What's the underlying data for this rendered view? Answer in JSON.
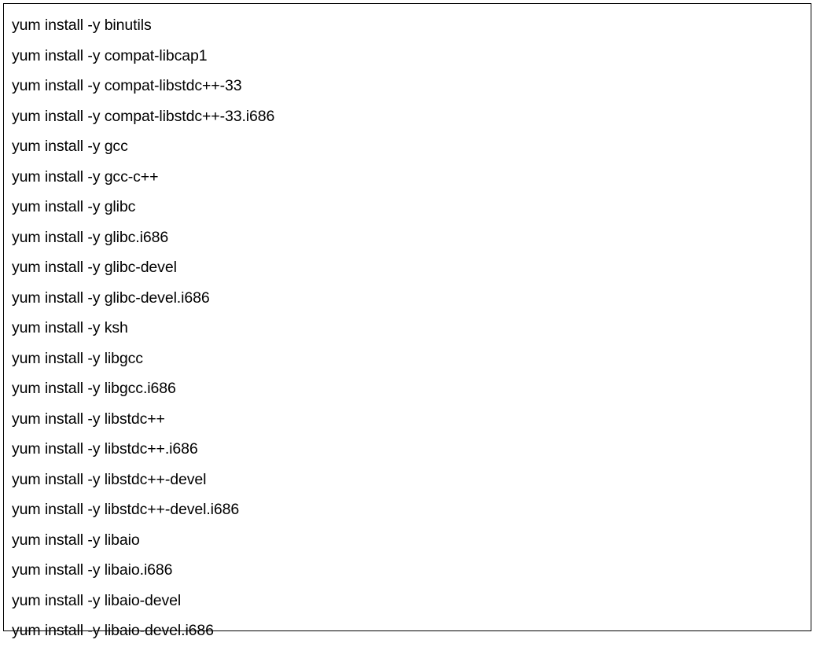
{
  "commands": [
    "yum install -y binutils",
    "yum install -y compat-libcap1",
    "yum install -y compat-libstdc++-33",
    "yum install -y compat-libstdc++-33.i686",
    "yum install -y gcc",
    "yum install -y gcc-c++",
    "yum install -y glibc",
    "yum install -y glibc.i686",
    "yum install -y glibc-devel",
    "yum install -y glibc-devel.i686",
    "yum install -y ksh",
    "yum install -y libgcc",
    "yum install -y libgcc.i686",
    "yum install -y libstdc++",
    "yum install -y libstdc++.i686",
    "yum install -y libstdc++-devel",
    "yum install -y libstdc++-devel.i686",
    "yum install -y libaio",
    "yum install -y libaio.i686",
    "yum install -y libaio-devel",
    "yum install -y libaio-devel.i686"
  ]
}
